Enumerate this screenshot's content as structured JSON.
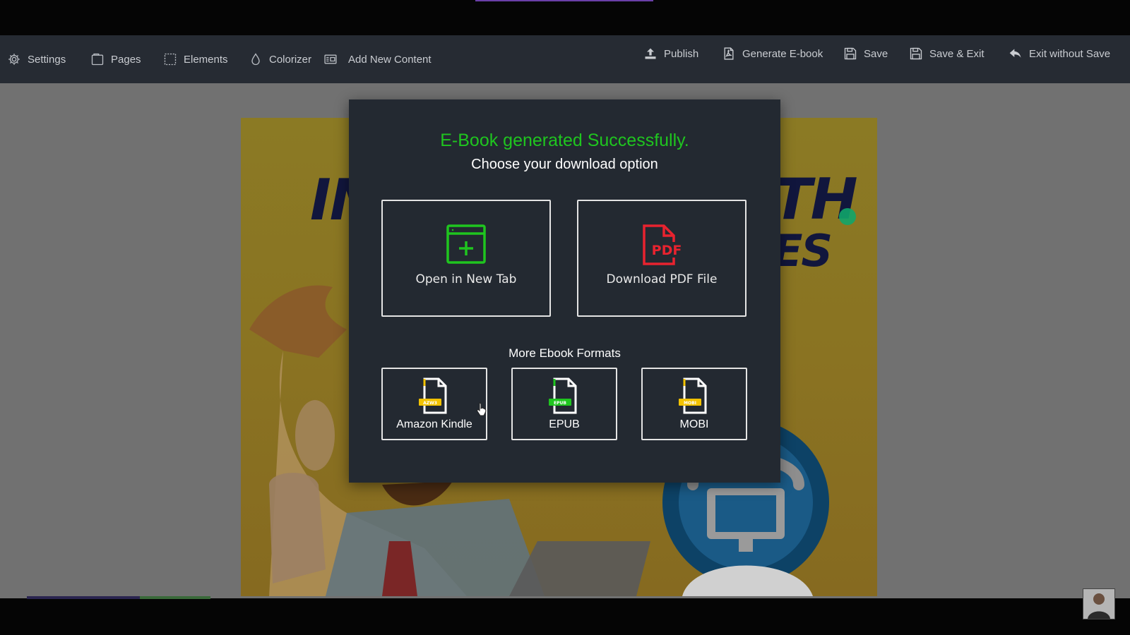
{
  "toolbar": {
    "left": [
      {
        "label": "Settings",
        "icon": "gear-icon"
      },
      {
        "label": "Pages",
        "icon": "pages-icon"
      },
      {
        "label": "Elements",
        "icon": "elements-icon"
      },
      {
        "label": "Colorizer",
        "icon": "droplet-icon"
      },
      {
        "label": "Add New Content",
        "icon": "add-content-icon"
      }
    ],
    "right": [
      {
        "label": "Publish",
        "icon": "upload-icon"
      },
      {
        "label": "Generate E-book",
        "icon": "pdf-doc-icon"
      },
      {
        "label": "Save",
        "icon": "floppy-icon"
      },
      {
        "label": "Save & Exit",
        "icon": "floppy-icon"
      },
      {
        "label": "Exit without Save",
        "icon": "reply-arrow-icon"
      }
    ]
  },
  "ebook": {
    "cover_left_text": "IN",
    "cover_right_text_1": "TH",
    "cover_right_text_2": "IES"
  },
  "modal": {
    "title": "E-Book generated Successfully.",
    "subtitle": "Choose your download option",
    "open_tab_label": "Open in New Tab",
    "download_pdf_label": "Download PDF File",
    "pdf_badge": "PDF",
    "more_formats_title": "More Ebook Formats",
    "formats": [
      {
        "label": "Amazon Kindle",
        "badge": "AZW3",
        "badge_color": "#f2c200"
      },
      {
        "label": "EPUB",
        "badge": "EPUB",
        "badge_color": "#1fc51f"
      },
      {
        "label": "MOBI",
        "badge": "MOBI",
        "badge_color": "#f2c200"
      }
    ]
  },
  "colors": {
    "success_green": "#1fc51f",
    "pdf_red": "#e8232f",
    "toolbar_bg": "#262b33",
    "modal_bg": "#232931"
  }
}
